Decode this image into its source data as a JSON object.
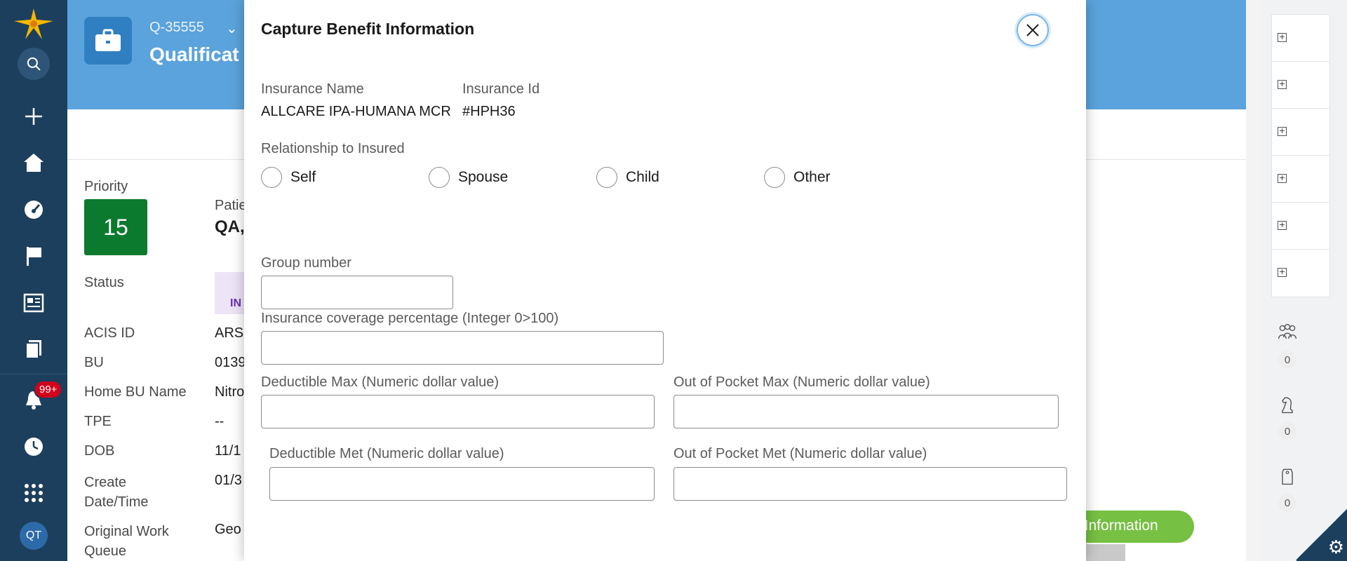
{
  "nav": {
    "items": [
      {
        "name": "logo",
        "icon": "logo-star-icon"
      },
      {
        "name": "search",
        "icon": "search-icon"
      },
      {
        "name": "create",
        "icon": "plus-icon"
      },
      {
        "name": "home",
        "icon": "home-icon"
      },
      {
        "name": "dashboard",
        "icon": "gauge-icon"
      },
      {
        "name": "flag",
        "icon": "flag-icon"
      },
      {
        "name": "news",
        "icon": "newspaper-icon"
      },
      {
        "name": "documents",
        "icon": "documents-icon"
      },
      {
        "name": "notifications",
        "icon": "bell-icon"
      },
      {
        "name": "history",
        "icon": "history-icon"
      },
      {
        "name": "apps",
        "icon": "grid-icon"
      }
    ],
    "notification_badge": "99+",
    "avatar_initials": "QT"
  },
  "case": {
    "id": "Q-35555",
    "title": "Qualificat",
    "priority_label": "Priority",
    "priority_value": "15",
    "patient_label": "Patie",
    "patient_name": "QA,",
    "status_label": "Status",
    "status_value": "IN",
    "fields": [
      {
        "label": "ACIS ID",
        "value": "ARS"
      },
      {
        "label": "BU",
        "value": "0139"
      },
      {
        "label": "Home BU Name",
        "value": "Nitro"
      },
      {
        "label": "TPE",
        "value": "--"
      },
      {
        "label": "DOB",
        "value": "11/1"
      },
      {
        "label": "Create Date/Time",
        "value": "01/3"
      },
      {
        "label": "Original Work Queue",
        "value": "Geo"
      }
    ],
    "green_button": "t Information"
  },
  "right_panel": {
    "counts": [
      {
        "icon": "people-icon",
        "count": "0"
      },
      {
        "icon": "chess-knight-icon",
        "count": "0"
      },
      {
        "icon": "tag-icon",
        "count": "0"
      }
    ]
  },
  "modal": {
    "title": "Capture Benefit Information",
    "insurance_name_label": "Insurance Name",
    "insurance_name_value": "ALLCARE IPA-HUMANA MCR",
    "insurance_id_label": "Insurance Id",
    "insurance_id_value": "#HPH36",
    "relationship_label": "Relationship to Insured",
    "relationship_options": [
      "Self",
      "Spouse",
      "Child",
      "Other"
    ],
    "group_number_label": "Group number",
    "group_number_value": "",
    "coverage_label": "Insurance coverage percentage (Integer 0>100)",
    "coverage_value": "",
    "deductible_max_label": "Deductible Max (Numeric dollar value)",
    "deductible_max_value": "",
    "oop_max_label": "Out of Pocket Max (Numeric dollar value)",
    "oop_max_value": "",
    "deductible_met_label": "Deductible Met (Numeric dollar value)",
    "deductible_met_value": "",
    "oop_met_label": "Out of Pocket Met (Numeric dollar value)",
    "oop_met_value": ""
  }
}
